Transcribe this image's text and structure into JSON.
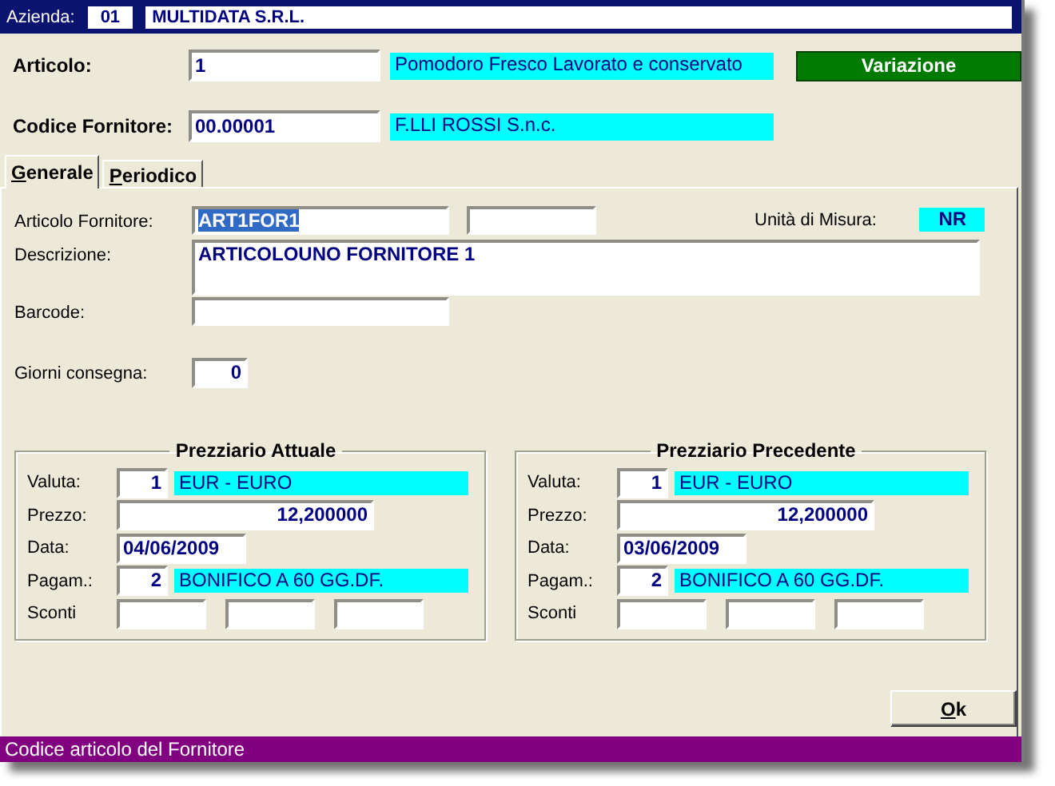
{
  "header": {
    "label": "Azienda:",
    "code": "01",
    "name": "MULTIDATA S.R.L."
  },
  "top_fields": [
    {
      "label": "Articolo:",
      "value": "1",
      "description": "Pomodoro Fresco Lavorato e conservato"
    },
    {
      "label": "Codice Fornitore:",
      "value": "00.00001",
      "description": "F.LLI ROSSI S.n.c."
    }
  ],
  "mode_button": {
    "label": "Variazione"
  },
  "tabs": [
    {
      "label": "Generale",
      "selected": true
    },
    {
      "label": "Periodico",
      "selected": false
    }
  ],
  "general": {
    "articolo_fornitore": {
      "label": "Articolo Fornitore:",
      "value": "ART1FOR1",
      "text_selected": true
    },
    "unit": {
      "label": "Unità di Misura:",
      "value": "NR"
    },
    "descrizione": {
      "label": "Descrizione:",
      "value": "ARTICOLOUNO FORNITORE 1"
    },
    "barcode": {
      "label": "Barcode:"
    },
    "giorni": {
      "label": "Giorni consegna:",
      "value": "0"
    }
  },
  "price_lists": [
    {
      "title": "Prezziario Attuale",
      "rows": [
        {
          "kind": "code",
          "label": "Valuta:",
          "code": "1",
          "name": "EUR - EURO"
        },
        {
          "kind": "amount",
          "label": "Prezzo:",
          "value": "12,200000"
        },
        {
          "kind": "date",
          "label": "Data:",
          "value": "04/06/2009"
        },
        {
          "kind": "code",
          "label": "Pagam.:",
          "code": "2",
          "name": "BONIFICO A 60 GG.DF."
        },
        {
          "kind": "discounts",
          "label": "Sconti"
        }
      ]
    },
    {
      "title": "Prezziario Precedente",
      "rows": [
        {
          "kind": "code",
          "label": "Valuta:",
          "code": "1",
          "name": "EUR - EURO"
        },
        {
          "kind": "amount",
          "label": "Prezzo:",
          "value": "12,200000"
        },
        {
          "kind": "date",
          "label": "Data:",
          "value": "03/06/2009"
        },
        {
          "kind": "code",
          "label": "Pagam.:",
          "code": "2",
          "name": "BONIFICO A 60 GG.DF."
        },
        {
          "kind": "discounts",
          "label": "Sconti"
        }
      ]
    }
  ],
  "ok_button": {
    "label": "Ok"
  },
  "status_bar": {
    "text": "Codice articolo del Fornitore"
  }
}
